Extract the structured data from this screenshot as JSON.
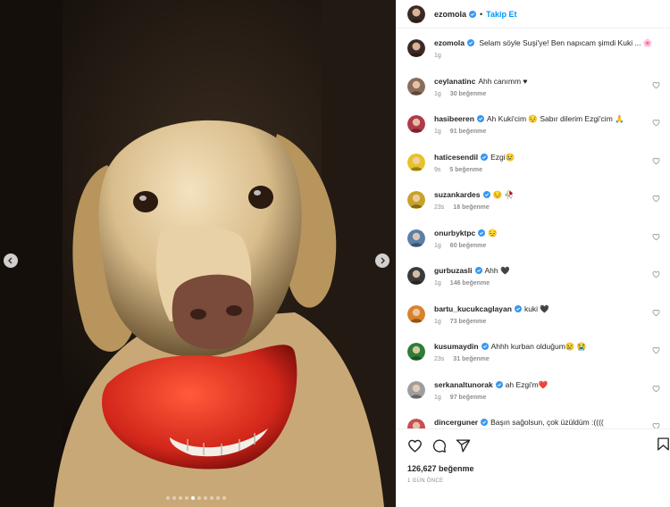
{
  "post": {
    "username": "ezomola",
    "follow_label": "Takip Et",
    "separator": "•",
    "total_likes": "126,627 beğenme",
    "time_ago": "1 GÜN ÖNCE",
    "carousel": {
      "count": 10,
      "active_index": 4
    }
  },
  "caption": {
    "username": "ezomola",
    "text": "Selam söyle Suşi'ye! Ben napıcam şimdi Kuki ... 🌸",
    "time": "1g"
  },
  "comments": [
    {
      "username": "ceylanatinc",
      "verified": false,
      "text": "Ahh canımm ♥",
      "time": "1g",
      "likes": "30 beğenme",
      "avatar_color": "#8a6d5a"
    },
    {
      "username": "hasibeeren",
      "verified": true,
      "text": "Ah Kuki'cim 😔 Sabır dilerim Ezgi'cim 🙏",
      "time": "1g",
      "likes": "91 beğenme",
      "avatar_color": "#b03a48"
    },
    {
      "username": "haticesendil",
      "verified": true,
      "text": "Ezgi😢",
      "time": "9s",
      "likes": "5 beğenme",
      "avatar_color": "#e6c229"
    },
    {
      "username": "suzankardes",
      "verified": true,
      "text": "😔 🥀",
      "time": "23s",
      "likes": "18 beğenme",
      "avatar_color": "#c9a227"
    },
    {
      "username": "onurbyktpc",
      "verified": true,
      "text": "😔",
      "time": "1g",
      "likes": "60 beğenme",
      "avatar_color": "#5b7fa6"
    },
    {
      "username": "gurbuzasli",
      "verified": true,
      "text": "Ahh 🖤",
      "time": "1g",
      "likes": "146 beğenme",
      "avatar_color": "#3a3a3a"
    },
    {
      "username": "bartu_kucukcaglayan",
      "verified": true,
      "text": "kuki 🖤",
      "time": "1g",
      "likes": "73 beğenme",
      "avatar_color": "#d9822b"
    },
    {
      "username": "kusumaydin",
      "verified": true,
      "text": "Ahhh kurban olduğum😢 😭",
      "time": "23s",
      "likes": "31 beğenme",
      "avatar_color": "#2e7d32"
    },
    {
      "username": "serkanaltunorak",
      "verified": true,
      "text": "ah Ezgi'm❤️",
      "time": "1g",
      "likes": "97 beğenme",
      "avatar_color": "#9e9e9e"
    },
    {
      "username": "dincerguner",
      "verified": true,
      "text": "Başın sağolsun, çok üzüldüm :((((",
      "time": "",
      "likes": "",
      "avatar_color": "#c65050"
    }
  ],
  "colors": {
    "link_blue": "#0095f6",
    "verified_blue": "#3897f0",
    "muted": "#8e8e8e"
  },
  "icons": [
    "verified-badge-icon",
    "heart-icon",
    "comment-icon",
    "share-icon",
    "bookmark-icon",
    "chevron-left-icon",
    "chevron-right-icon"
  ]
}
